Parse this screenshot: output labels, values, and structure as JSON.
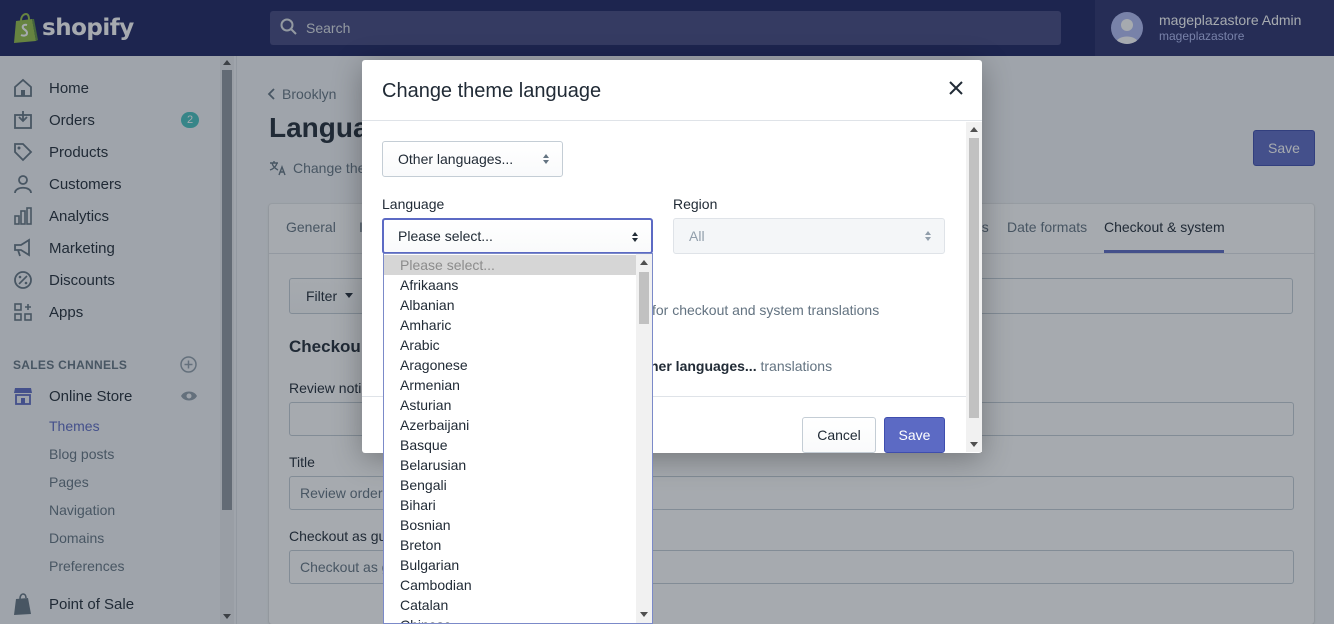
{
  "topbar": {
    "logo_text": "shopify",
    "search_placeholder": "Search",
    "user_name": "mageplazastore Admin",
    "user_store": "mageplazastore"
  },
  "sidebar": {
    "items": [
      {
        "label": "Home",
        "icon": "home-icon"
      },
      {
        "label": "Orders",
        "icon": "orders-icon",
        "badge": "2"
      },
      {
        "label": "Products",
        "icon": "tag-icon"
      },
      {
        "label": "Customers",
        "icon": "person-icon"
      },
      {
        "label": "Analytics",
        "icon": "bar-chart-icon"
      },
      {
        "label": "Marketing",
        "icon": "megaphone-icon"
      },
      {
        "label": "Discounts",
        "icon": "discount-icon"
      },
      {
        "label": "Apps",
        "icon": "apps-icon"
      }
    ],
    "sales_channels_heading": "SALES CHANNELS",
    "online_store": "Online Store",
    "sub_items": [
      "Themes",
      "Blog posts",
      "Pages",
      "Navigation",
      "Domains",
      "Preferences"
    ],
    "point_of_sale": "Point of Sale"
  },
  "main": {
    "breadcrumb": "Brooklyn",
    "title": "Langua",
    "subtitle": "Change the",
    "save_label": "Save",
    "tabs": [
      "General",
      "I",
      "ds",
      "Date formats",
      "Checkout & system"
    ],
    "filter_label": "Filter",
    "section_title": "Checkou",
    "fields": [
      {
        "label": "Review notic",
        "value": ""
      },
      {
        "label": "Title",
        "value": "Review order"
      },
      {
        "label": "Checkout as gu",
        "value": "Checkout as g"
      }
    ]
  },
  "modal": {
    "title": "Change theme language",
    "other_languages": "Other languages...",
    "language_label": "Language",
    "language_value": "Please select...",
    "region_label": "Region",
    "region_value": "All",
    "text1": "for checkout and system translations",
    "text2_bold": "her languages...",
    "text2_rest": " translations",
    "cancel_label": "Cancel",
    "save_label": "Save"
  },
  "dropdown": {
    "options": [
      "Please select...",
      "Afrikaans",
      "Albanian",
      "Amharic",
      "Arabic",
      "Aragonese",
      "Armenian",
      "Asturian",
      "Azerbaijani",
      "Basque",
      "Belarusian",
      "Bengali",
      "Bihari",
      "Bosnian",
      "Breton",
      "Bulgarian",
      "Cambodian",
      "Catalan",
      "Chinese"
    ]
  },
  "colors": {
    "topbar": "#1c2260",
    "accent": "#5c6ac4",
    "badge": "#47c1bf"
  }
}
